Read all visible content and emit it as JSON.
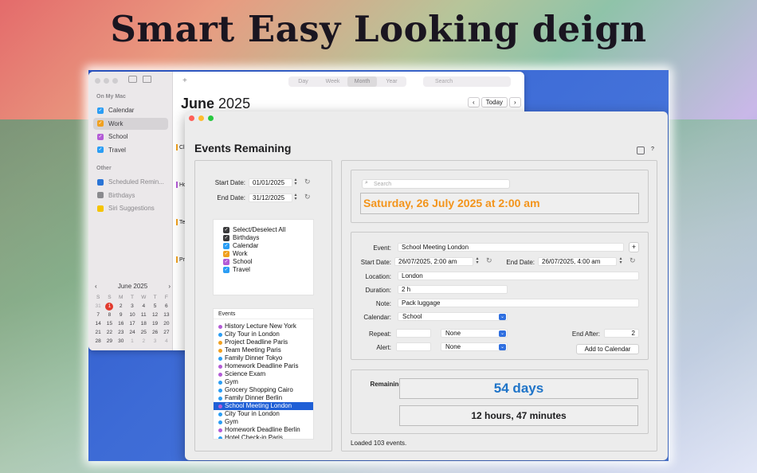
{
  "headline": "Smart Easy Looking deign",
  "calendar_app": {
    "toolbar": {
      "add_label": "+",
      "views": [
        "Day",
        "Week",
        "Month",
        "Year"
      ],
      "active_view": "Month",
      "search_placeholder": "Search",
      "today_label": "Today",
      "prev_label": "‹",
      "next_label": "›"
    },
    "month_name": "June",
    "year": "2025",
    "sidebar": {
      "section_on_my_mac": "On My Mac",
      "calendars": [
        {
          "label": "Calendar",
          "color": "#2a9df4"
        },
        {
          "label": "Work",
          "color": "#f0a020"
        },
        {
          "label": "School",
          "color": "#b35bd6"
        },
        {
          "label": "Travel",
          "color": "#2a9df4"
        }
      ],
      "section_other": "Other",
      "other": [
        {
          "label": "Scheduled Remin...",
          "color": "#2a74d6"
        },
        {
          "label": "Birthdays",
          "color": "#8a8a8e"
        },
        {
          "label": "Siri Suggestions",
          "color": "#f5c400"
        }
      ]
    },
    "mini_calendar": {
      "title": "June 2025",
      "prev": "‹",
      "next": "›",
      "weekdays": [
        "S",
        "S",
        "M",
        "T",
        "W",
        "T",
        "F"
      ],
      "rows": [
        [
          "31",
          "1",
          "2",
          "3",
          "4",
          "5",
          "6"
        ],
        [
          "7",
          "8",
          "9",
          "10",
          "11",
          "12",
          "13"
        ],
        [
          "14",
          "15",
          "16",
          "17",
          "18",
          "19",
          "20"
        ],
        [
          "21",
          "22",
          "23",
          "24",
          "25",
          "26",
          "27"
        ],
        [
          "28",
          "29",
          "30",
          "1",
          "2",
          "3",
          "4"
        ]
      ],
      "today": "1"
    },
    "event_snippets": [
      "Cl",
      "Ho",
      "Te",
      "Pr"
    ]
  },
  "events_window": {
    "title": "Events Remaining",
    "start_date_label": "Start Date:",
    "start_date": "01/01/2025",
    "end_date_label": "End Date:",
    "end_date": "31/12/2025",
    "filters": [
      {
        "label": "Select/Deselect All",
        "color": "#3a3a3c"
      },
      {
        "label": "Birthdays",
        "color": "#3a3a3c"
      },
      {
        "label": "Calendar",
        "color": "#2a9df4"
      },
      {
        "label": "Work",
        "color": "#f0a020"
      },
      {
        "label": "School",
        "color": "#b35bd6"
      },
      {
        "label": "Travel",
        "color": "#2a9df4"
      }
    ],
    "events_header": "Events",
    "events": [
      {
        "label": "History Lecture New York",
        "color": "#b35bd6"
      },
      {
        "label": "City Tour in London",
        "color": "#2a9df4"
      },
      {
        "label": "Project Deadline Paris",
        "color": "#f0a020"
      },
      {
        "label": "Team Meeting Paris",
        "color": "#f0a020"
      },
      {
        "label": "Family Dinner Tokyo",
        "color": "#2a9df4"
      },
      {
        "label": "Homework Deadline Paris",
        "color": "#b35bd6"
      },
      {
        "label": "Science Exam",
        "color": "#b35bd6"
      },
      {
        "label": "Gym",
        "color": "#2a9df4"
      },
      {
        "label": "Grocery Shopping Cairo",
        "color": "#2a9df4"
      },
      {
        "label": "Family Dinner Berlin",
        "color": "#2a9df4"
      },
      {
        "label": "School Meeting London",
        "color": "#b35bd6"
      },
      {
        "label": "City Tour in London",
        "color": "#2a9df4"
      },
      {
        "label": "Gym",
        "color": "#2a9df4"
      },
      {
        "label": "Homework Deadline Berlin",
        "color": "#b35bd6"
      },
      {
        "label": "Hotel Check-in Paris",
        "color": "#2a9df4"
      }
    ],
    "selected_event": "School Meeting London",
    "search_placeholder": "Search",
    "current_datetime": "Saturday, 26 July 2025 at 2:00 am",
    "form": {
      "event_label": "Event:",
      "event_value": "School Meeting London",
      "add_label": "+",
      "start_label": "Start Date:",
      "start_value": "26/07/2025,  2:00 am",
      "end_label": "End Date:",
      "end_value": "26/07/2025,  4:00 am",
      "location_label": "Location:",
      "location_value": "London",
      "duration_label": "Duration:",
      "duration_value": "2 h",
      "note_label": "Note:",
      "note_value": "Pack luggage",
      "calendar_label": "Calendar:",
      "calendar_value": "School",
      "repeat_label": "Repeat:",
      "repeat_value": "None",
      "alert_label": "Alert:",
      "alert_value": "None",
      "end_after_label": "End After:",
      "end_after_value": "2",
      "add_calendar_label": "Add to Calendar"
    },
    "remaining_label": "Remaining:",
    "remaining_days": "54 days",
    "remaining_time": "12 hours, 47 minutes",
    "status": "Loaded 103 events.",
    "colors": {
      "accent_orange": "#f3941b",
      "accent_blue": "#1f74c8",
      "selection": "#1f5fd6"
    }
  }
}
